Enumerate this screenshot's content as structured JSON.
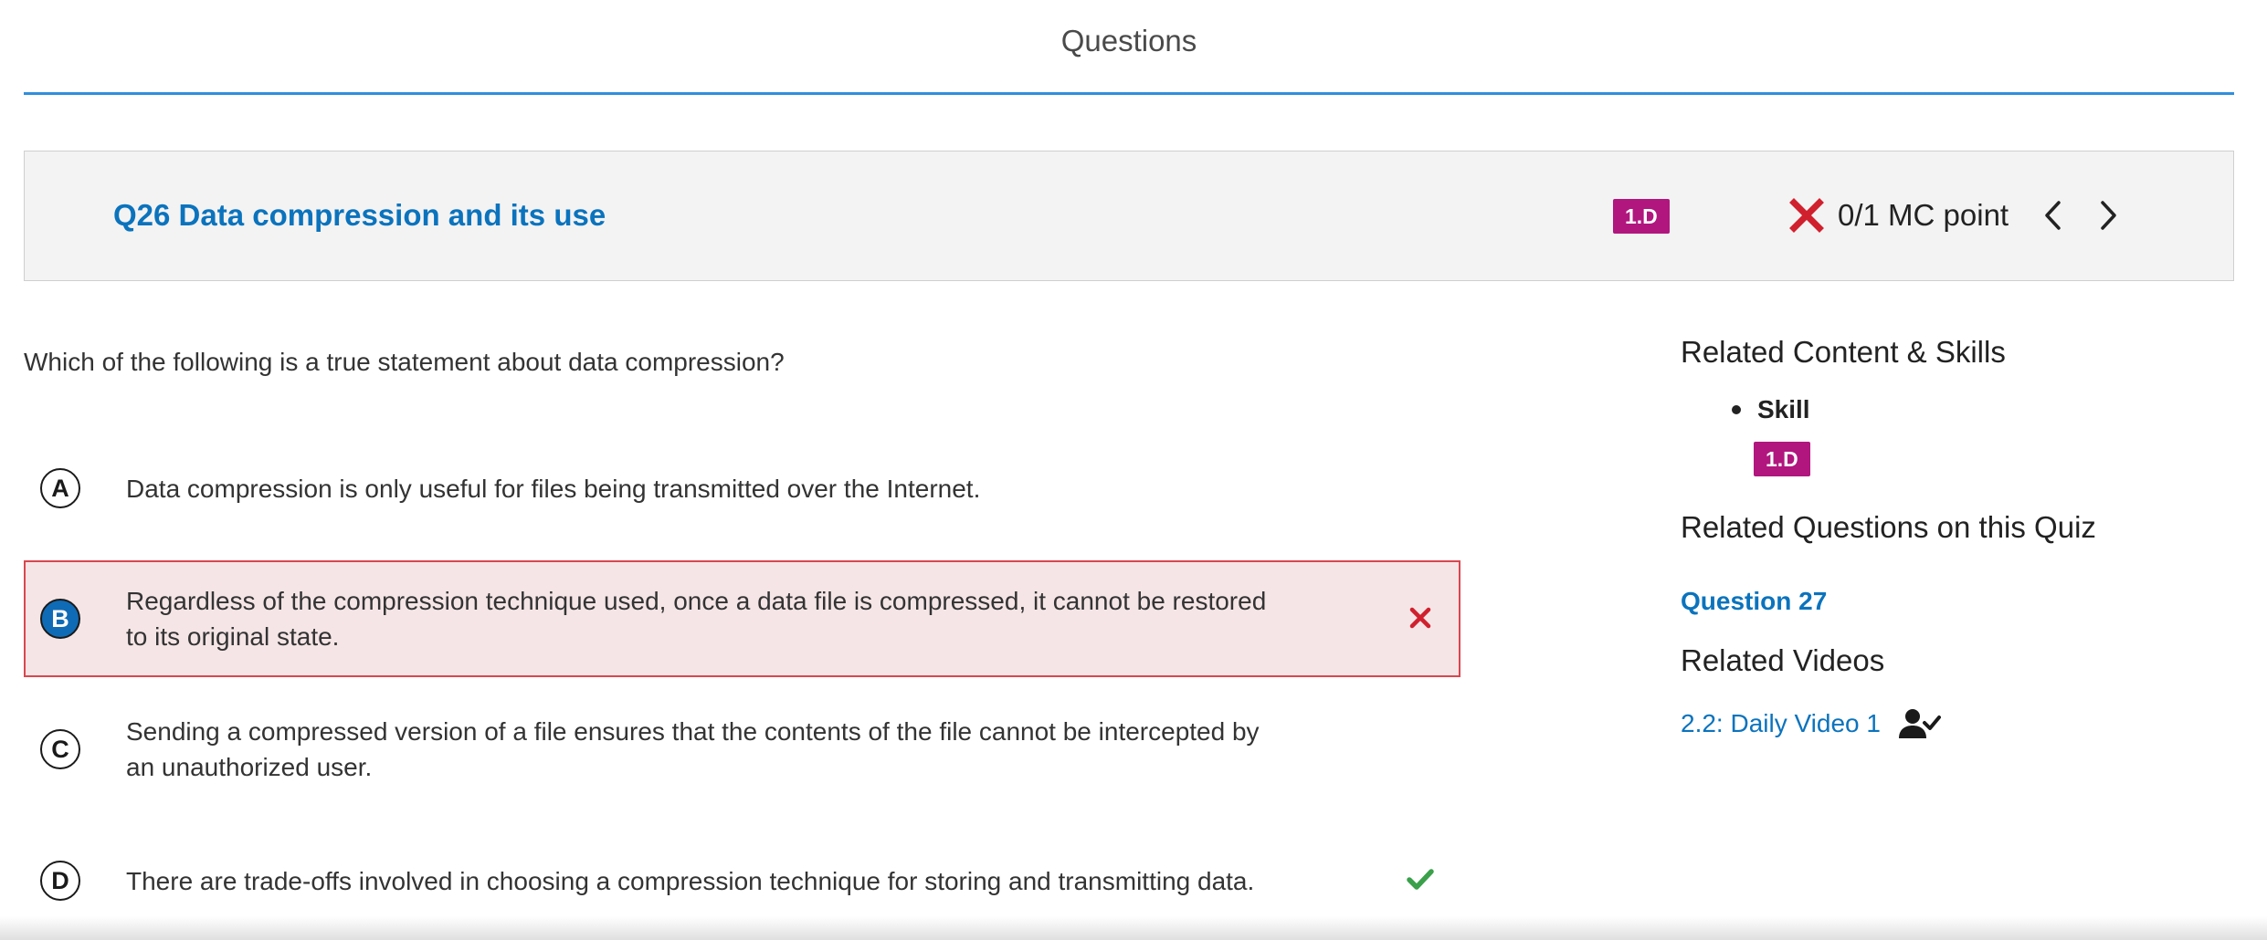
{
  "header": {
    "title": "Questions"
  },
  "question": {
    "title": "Q26 Data compression and its use",
    "skill": "1.D",
    "score": "0/1 MC point",
    "prompt": "Which of the following is a true statement about data compression?",
    "choices": [
      {
        "letter": "A",
        "text": "Data compression is only useful for files being transmitted over the Internet.",
        "state": "none"
      },
      {
        "letter": "B",
        "text": "Regardless of the compression technique used, once a data file is compressed, it cannot be restored to its original state.",
        "state": "selected-incorrect"
      },
      {
        "letter": "C",
        "text": "Sending a compressed version of a file ensures that the contents of the file cannot be intercepted by an unauthorized user.",
        "state": "none"
      },
      {
        "letter": "D",
        "text": "There are trade-offs involved in choosing a compression technique for storing and transmitting data.",
        "state": "correct"
      }
    ]
  },
  "sidebar": {
    "related_heading": "Related Content & Skills",
    "skill_label": "Skill",
    "skill_badge": "1.D",
    "related_questions_heading": "Related Questions on this Quiz",
    "related_question_link": "Question 27",
    "related_videos_heading": "Related Videos",
    "video_link": "2.2: Daily Video 1"
  },
  "colors": {
    "accent_blue": "#0b73bd",
    "header_rule": "#2f8fdc",
    "skill_badge": "#b0167e",
    "incorrect_red": "#d0202e",
    "correct_green": "#3aa04a",
    "selected_bg": "#f5e5e6"
  },
  "icons": {
    "score": "x-icon",
    "prev": "chevron-left-icon",
    "next": "chevron-right-icon",
    "wrong": "close-icon",
    "right": "checkmark-icon",
    "video": "person-check-icon"
  }
}
